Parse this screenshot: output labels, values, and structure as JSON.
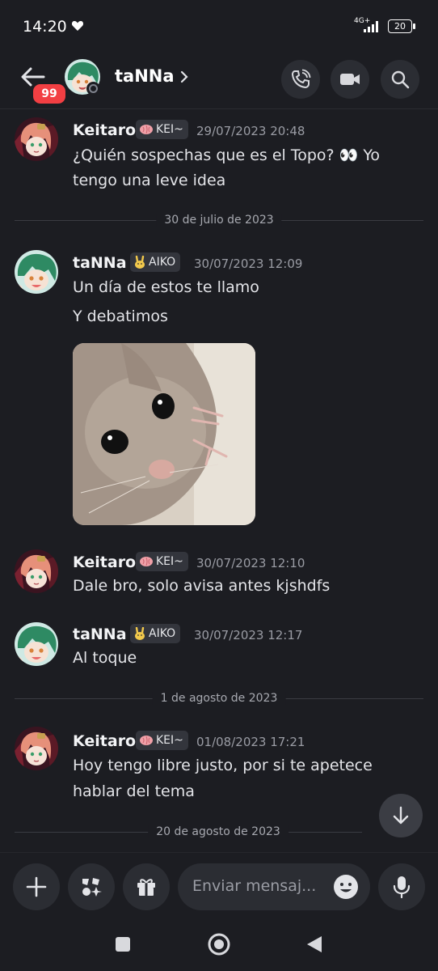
{
  "status_bar": {
    "time": "14:20",
    "network": "4G+",
    "battery": "20"
  },
  "header": {
    "unread_count": "99",
    "channel_name": "taNNa",
    "icons": [
      "back-arrow-icon",
      "phone-call-icon",
      "video-camera-icon",
      "search-icon",
      "chevron-right-icon"
    ]
  },
  "messages": [
    {
      "author": "Keitaro",
      "tag": "KEI~",
      "tag_icon": "brain-icon",
      "timestamp": "29/07/2023 20:48",
      "lines": [
        "¿Quién sospechas que es el Topo? 👀 Yo",
        "tengo una leve idea"
      ]
    },
    {
      "author": "taNNa",
      "tag": "AIKO",
      "tag_icon": "bunny-icon",
      "timestamp": "30/07/2023 12:09",
      "lines": [
        "Un día de estos te llamo",
        "Y debatimos"
      ],
      "attachment": "hamster-photo"
    },
    {
      "author": "Keitaro",
      "tag": "KEI~",
      "tag_icon": "brain-icon",
      "timestamp": "30/07/2023 12:10",
      "lines": [
        "Dale bro, solo avisa antes kjshdfs"
      ]
    },
    {
      "author": "taNNa",
      "tag": "AIKO",
      "tag_icon": "bunny-icon",
      "timestamp": "30/07/2023 12:17",
      "lines": [
        "Al toque"
      ]
    },
    {
      "author": "Keitaro",
      "tag": "KEI~",
      "tag_icon": "brain-icon",
      "timestamp": "01/08/2023 17:21",
      "lines": [
        "Hoy tengo libre justo, por si te apetece",
        "hablar del tema"
      ]
    }
  ],
  "dividers": [
    "30 de julio de 2023",
    "1 de agosto de 2023",
    "20 de agosto de 2023"
  ],
  "composer": {
    "placeholder": "Enviar mensaj...",
    "icons": [
      "plus-icon",
      "apps-icon",
      "gift-icon",
      "emoji-icon",
      "microphone-icon"
    ]
  },
  "colors": {
    "background": "#1c1d22",
    "button": "#2b2d33",
    "badge": "#f23f43",
    "muted": "#9a9ca4"
  }
}
